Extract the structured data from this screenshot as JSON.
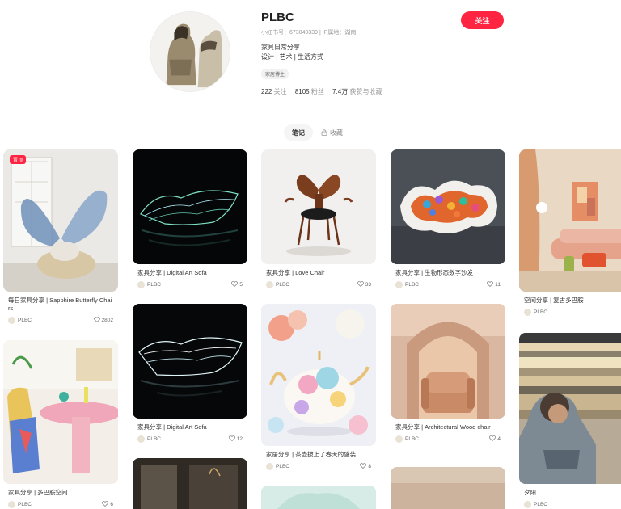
{
  "profile": {
    "name": "PLBC",
    "meta": "小红书号：673049339 | IP属地：湖南",
    "bio_line1": "家具日常分享",
    "bio_line2": "设计 | 艺术 | 生活方式",
    "tag": "家居博主",
    "following_count": "222",
    "following_label": "关注",
    "followers_count": "8105",
    "followers_label": "粉丝",
    "likes_count": "7.4万",
    "likes_label": "获赞与收藏",
    "follow_button": "关注"
  },
  "tabs": {
    "notes": "笔记",
    "collect": "收藏"
  },
  "cards": [
    {
      "title": "每日家具分享 | Sapphire Butterfly Chairs",
      "author": "PLBC",
      "likes": "2802",
      "badge": "置顶"
    },
    {
      "title": "家具分享 | 多巴胺空间",
      "author": "PLBC",
      "likes": "6"
    },
    {
      "title": "家具分享 | Digital Art Sofa",
      "author": "PLBC",
      "likes": "5"
    },
    {
      "title": "家具分享 | Digital Art Sofa",
      "author": "PLBC",
      "likes": "12"
    },
    {
      "title": "家具分享 | Love Chair",
      "author": "PLBC",
      "likes": "33"
    },
    {
      "title": "家居分享 | 茶壶披上了春天的盛装",
      "author": "PLBC",
      "likes": "8"
    },
    {
      "title": "家具分享 | 生物形态数字沙发",
      "author": "PLBC",
      "likes": "11"
    },
    {
      "title": "家具分享 | Architectural Wood chair",
      "author": "PLBC",
      "likes": "4"
    },
    {
      "title": "空间分享 | 复古多巴胺",
      "author": "PLBC",
      "likes": ""
    },
    {
      "title": "夕阳",
      "author": "PLBC",
      "likes": ""
    }
  ],
  "colors": {
    "accent": "#ff2442",
    "text": "#333333",
    "muted": "#999999"
  },
  "icons": [
    "heart-icon",
    "lock-icon",
    "avatar-icon"
  ]
}
